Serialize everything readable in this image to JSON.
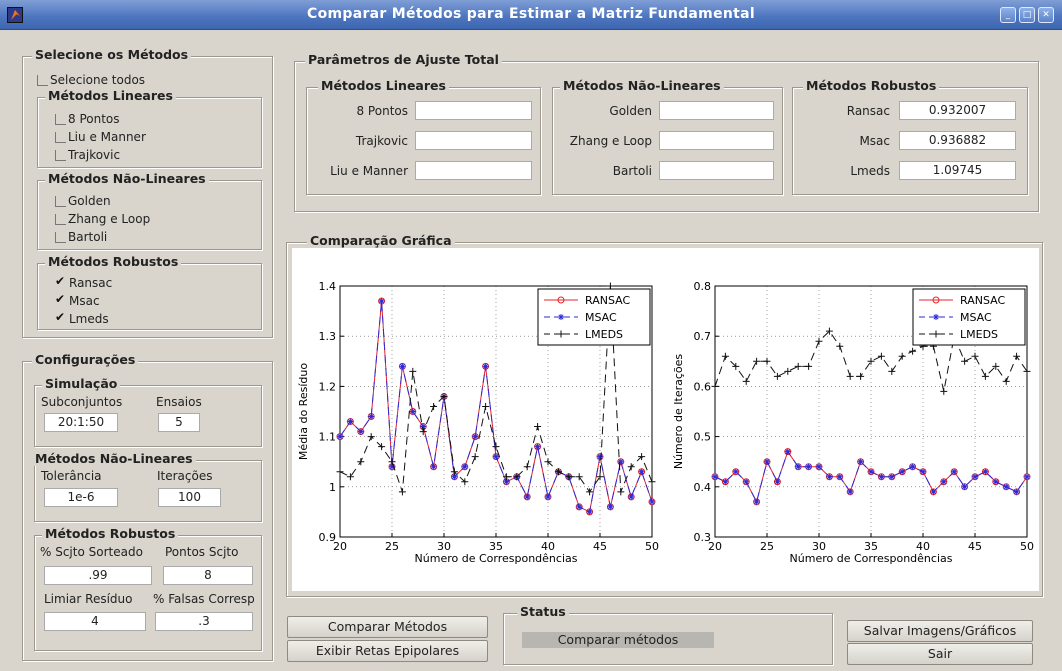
{
  "window": {
    "title": "Comparar Métodos para Estimar a Matriz Fundamental",
    "min_glyph": "_",
    "max_glyph": "□",
    "close_glyph": "✕"
  },
  "select": {
    "title": "Selecione os Métodos",
    "all": {
      "label": "Selecione todos",
      "checked": false
    },
    "linear": {
      "title": "Métodos Lineares",
      "items": [
        {
          "label": "8 Pontos",
          "checked": false
        },
        {
          "label": "Liu e Manner",
          "checked": false
        },
        {
          "label": "Trajkovic",
          "checked": false
        }
      ]
    },
    "nonlinear": {
      "title": "Métodos Não-Lineares",
      "items": [
        {
          "label": "Golden",
          "checked": false
        },
        {
          "label": "Zhang e Loop",
          "checked": false
        },
        {
          "label": "Bartoli",
          "checked": false
        }
      ]
    },
    "robust": {
      "title": "Métodos Robustos",
      "items": [
        {
          "label": "Ransac",
          "checked": true
        },
        {
          "label": "Msac",
          "checked": true
        },
        {
          "label": "Lmeds",
          "checked": true
        }
      ]
    }
  },
  "config": {
    "title": "Configurações",
    "sim": {
      "title": "Simulação",
      "subsets_label": "Subconjuntos",
      "subsets_value": "20:1:50",
      "trials_label": "Ensaios",
      "trials_value": "5"
    },
    "nonlinear": {
      "title": "Métodos Não-Lineares",
      "tol_label": "Tolerância",
      "tol_value": "1e-6",
      "iter_label": "Iterações",
      "iter_value": "100"
    },
    "robust": {
      "title": "Métodos Robustos",
      "pct_label": "% Scjto Sorteado",
      "pct_value": ".99",
      "pts_label": "Pontos Scjto",
      "pts_value": "8",
      "thr_label": "Limiar Resíduo",
      "thr_value": "4",
      "false_label": "% Falsas Corresp",
      "false_value": ".3"
    }
  },
  "params": {
    "title": "Parâmetros de Ajuste Total",
    "linear": {
      "title": "Métodos Lineares",
      "rows": [
        {
          "label": "8 Pontos",
          "value": ""
        },
        {
          "label": "Trajkovic",
          "value": ""
        },
        {
          "label": "Liu e Manner",
          "value": ""
        }
      ]
    },
    "nonlinear": {
      "title": "Métodos Não-Lineares",
      "rows": [
        {
          "label": "Golden",
          "value": ""
        },
        {
          "label": "Zhang e Loop",
          "value": ""
        },
        {
          "label": "Bartoli",
          "value": ""
        }
      ]
    },
    "robust": {
      "title": "Métodos Robustos",
      "rows": [
        {
          "label": "Ransac",
          "value": "0.932007"
        },
        {
          "label": "Msac",
          "value": "0.936882"
        },
        {
          "label": "Lmeds",
          "value": "1.09745"
        }
      ]
    }
  },
  "graph_title": "Comparação Gráfica",
  "status": {
    "title": "Status",
    "text": "Comparar métodos"
  },
  "buttons": {
    "compare": "Comparar Métodos",
    "epipolar": "Exibir Retas Epipolares",
    "save": "Salvar Imagens/Gráficos",
    "exit": "Sair"
  },
  "colors": {
    "ransac": "#e8232a",
    "msac": "#2a2ad8",
    "lmeds": "#111111",
    "titlebar": "#4f77c0"
  },
  "chart_data": [
    {
      "type": "line",
      "xlabel": "Número de Correspondências",
      "ylabel": "Média do Resíduo",
      "xlim": [
        20,
        50
      ],
      "ylim": [
        0.9,
        1.4
      ],
      "xticks": [
        20,
        25,
        30,
        35,
        40,
        45,
        50
      ],
      "yticks": [
        0.9,
        1,
        1.1,
        1.2,
        1.3,
        1.4
      ],
      "ytick_labels": [
        "0.9",
        "1",
        "1.1",
        "1.2",
        "1.3",
        "1.4"
      ],
      "grid": true,
      "legend_position": "top-right",
      "x": [
        20,
        21,
        22,
        23,
        24,
        25,
        26,
        27,
        28,
        29,
        30,
        31,
        32,
        33,
        34,
        35,
        36,
        37,
        38,
        39,
        40,
        41,
        42,
        43,
        44,
        45,
        46,
        47,
        48,
        49,
        50
      ],
      "series": [
        {
          "name": "RANSAC",
          "color": "#e8232a",
          "dash": "",
          "marker": "circle",
          "values": [
            1.1,
            1.13,
            1.11,
            1.14,
            1.37,
            1.04,
            1.24,
            1.15,
            1.12,
            1.04,
            1.18,
            1.02,
            1.04,
            1.1,
            1.24,
            1.06,
            1.01,
            1.02,
            0.98,
            1.08,
            0.98,
            1.03,
            1.02,
            0.96,
            0.95,
            1.06,
            0.96,
            1.05,
            0.98,
            1.03,
            0.97
          ]
        },
        {
          "name": "MSAC",
          "color": "#2a2ad8",
          "dash": "8,5",
          "marker": "star",
          "values": [
            1.1,
            1.13,
            1.11,
            1.14,
            1.37,
            1.04,
            1.24,
            1.15,
            1.12,
            1.04,
            1.18,
            1.02,
            1.04,
            1.1,
            1.24,
            1.06,
            1.01,
            1.02,
            0.98,
            1.08,
            0.98,
            1.03,
            1.02,
            0.96,
            0.95,
            1.06,
            0.96,
            1.05,
            0.98,
            1.03,
            0.97
          ]
        },
        {
          "name": "LMEDS",
          "color": "#111111",
          "dash": "8,5",
          "marker": "plus",
          "values": [
            1.03,
            1.02,
            1.05,
            1.1,
            1.08,
            1.05,
            0.99,
            1.23,
            1.11,
            1.16,
            1.18,
            1.03,
            1.01,
            1.06,
            1.16,
            1.08,
            1.02,
            1.02,
            1.04,
            1.12,
            1.05,
            1.03,
            1.02,
            1.02,
            0.99,
            1.02,
            1.4,
            0.99,
            1.04,
            1.06,
            1.01
          ]
        }
      ]
    },
    {
      "type": "line",
      "xlabel": "Número de Correspondências",
      "ylabel": "Número de Iterações",
      "xlim": [
        20,
        50
      ],
      "ylim": [
        0.3,
        0.8
      ],
      "xticks": [
        20,
        25,
        30,
        35,
        40,
        45,
        50
      ],
      "yticks": [
        0.3,
        0.4,
        0.5,
        0.6,
        0.7,
        0.8
      ],
      "ytick_labels": [
        "0.3",
        "0.4",
        "0.5",
        "0.6",
        "0.7",
        "0.8"
      ],
      "grid": true,
      "legend_position": "top-right",
      "x": [
        20,
        21,
        22,
        23,
        24,
        25,
        26,
        27,
        28,
        29,
        30,
        31,
        32,
        33,
        34,
        35,
        36,
        37,
        38,
        39,
        40,
        41,
        42,
        43,
        44,
        45,
        46,
        47,
        48,
        49,
        50
      ],
      "series": [
        {
          "name": "RANSAC",
          "color": "#e8232a",
          "dash": "",
          "marker": "circle",
          "values": [
            0.42,
            0.41,
            0.43,
            0.41,
            0.37,
            0.45,
            0.41,
            0.47,
            0.44,
            0.44,
            0.44,
            0.42,
            0.42,
            0.39,
            0.45,
            0.43,
            0.42,
            0.42,
            0.43,
            0.44,
            0.43,
            0.39,
            0.41,
            0.43,
            0.4,
            0.42,
            0.43,
            0.41,
            0.4,
            0.39,
            0.42
          ]
        },
        {
          "name": "MSAC",
          "color": "#2a2ad8",
          "dash": "8,5",
          "marker": "star",
          "values": [
            0.42,
            0.41,
            0.43,
            0.41,
            0.37,
            0.45,
            0.41,
            0.47,
            0.44,
            0.44,
            0.44,
            0.42,
            0.42,
            0.39,
            0.45,
            0.43,
            0.42,
            0.42,
            0.43,
            0.44,
            0.43,
            0.39,
            0.41,
            0.43,
            0.4,
            0.42,
            0.43,
            0.41,
            0.4,
            0.39,
            0.42
          ]
        },
        {
          "name": "LMEDS",
          "color": "#111111",
          "dash": "8,5",
          "marker": "plus",
          "values": [
            0.6,
            0.66,
            0.64,
            0.61,
            0.65,
            0.65,
            0.62,
            0.63,
            0.64,
            0.64,
            0.69,
            0.71,
            0.68,
            0.62,
            0.62,
            0.65,
            0.66,
            0.63,
            0.66,
            0.67,
            0.68,
            0.68,
            0.59,
            0.7,
            0.65,
            0.66,
            0.62,
            0.64,
            0.61,
            0.66,
            0.63
          ]
        }
      ]
    }
  ]
}
